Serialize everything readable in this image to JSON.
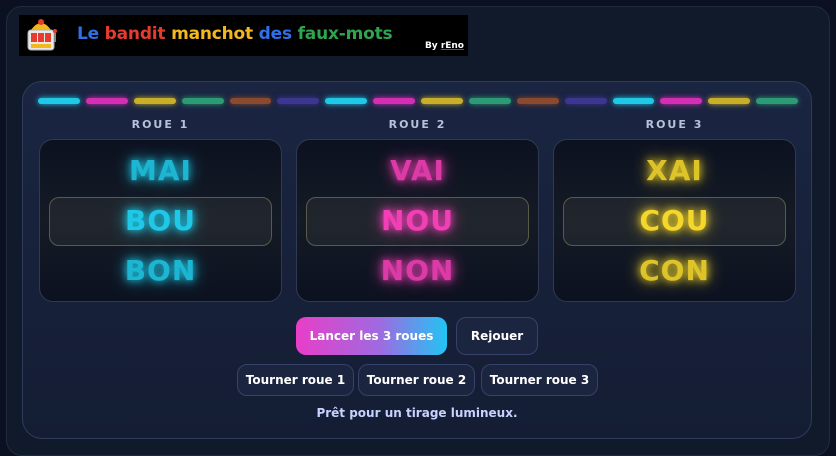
{
  "banner": {
    "title_words": [
      {
        "text": "Le",
        "color": "#2f6fe8"
      },
      {
        "text": "bandit",
        "color": "#e63b2e"
      },
      {
        "text": "manchot",
        "color": "#f4b81c"
      },
      {
        "text": "des",
        "color": "#2f6fe8"
      },
      {
        "text": "faux-mots",
        "color": "#2ea44f"
      }
    ],
    "byline_prefix": "By ",
    "byline_author": "rEno"
  },
  "lights": {
    "colors": [
      "#1fc8e6",
      "#d42fb4",
      "#c9ae2a",
      "#2c9a72",
      "#8a4a2e",
      "#3c3690"
    ]
  },
  "reels": [
    {
      "label": "ROUE 1",
      "color": "#1fc8e6",
      "symbols": {
        "top": "MAI",
        "middle": "BOU",
        "bottom": "BON"
      }
    },
    {
      "label": "ROUE 2",
      "color": "#f23fb6",
      "symbols": {
        "top": "VAI",
        "middle": "NOU",
        "bottom": "NON"
      }
    },
    {
      "label": "ROUE 3",
      "color": "#f4d72a",
      "symbols": {
        "top": "XAI",
        "middle": "COU",
        "bottom": "CON"
      }
    }
  ],
  "controls": {
    "spin_all_label": "Lancer les 3 roues",
    "replay_label": "Rejouer",
    "spin_reel_1_label": "Tourner roue 1",
    "spin_reel_2_label": "Tourner roue 2",
    "spin_reel_3_label": "Tourner roue 3"
  },
  "status_text": "Prêt pour un tirage lumineux."
}
